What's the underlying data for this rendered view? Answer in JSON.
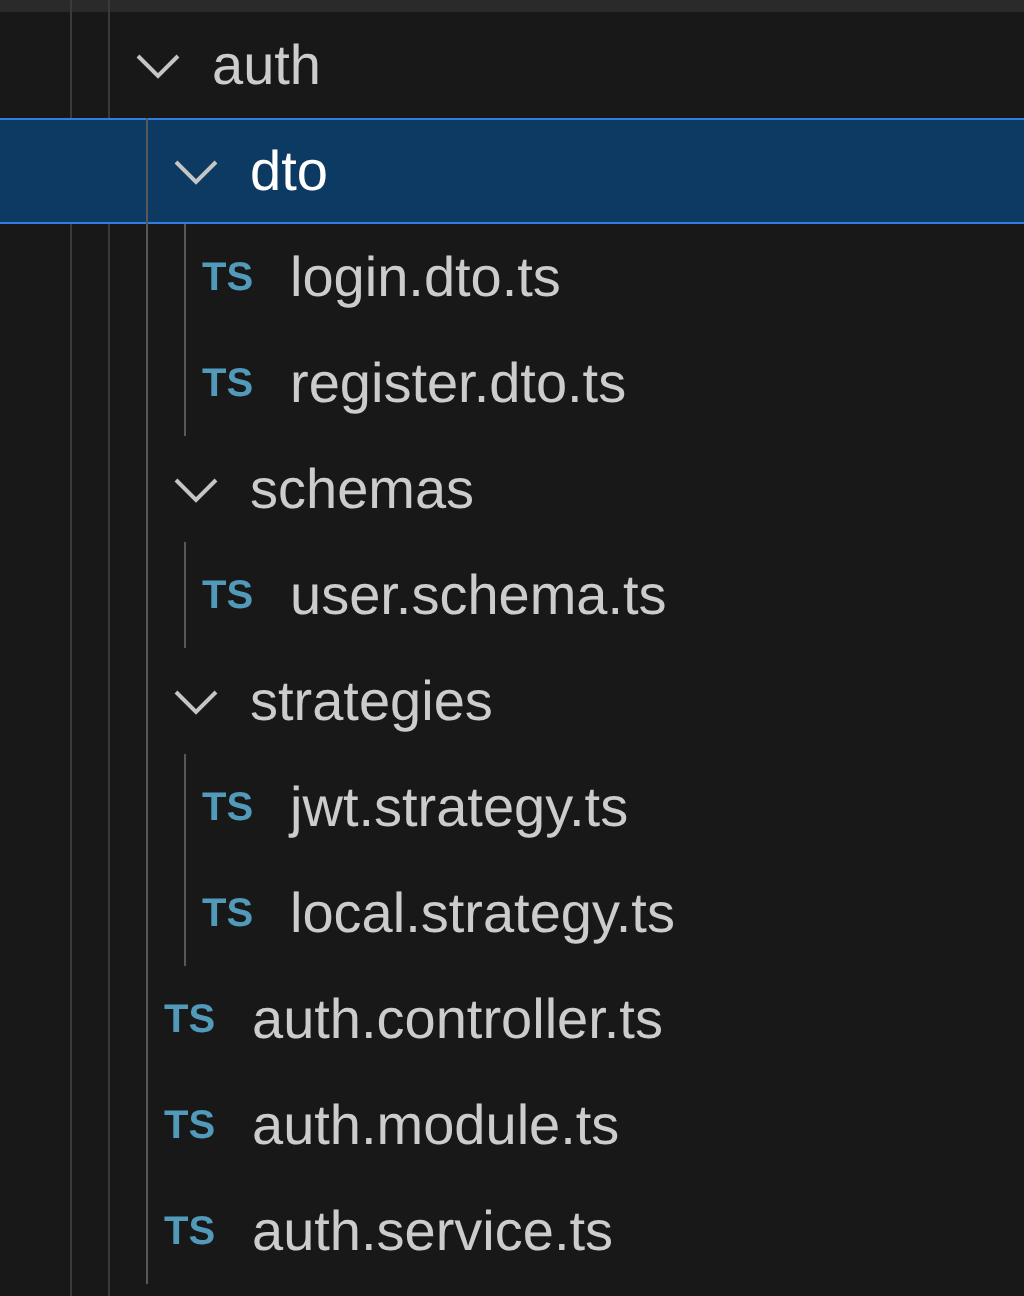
{
  "tree": [
    {
      "kind": "folder",
      "name": "auth",
      "expanded": true,
      "selected": false,
      "children": [
        {
          "kind": "folder",
          "name": "dto",
          "expanded": true,
          "selected": true,
          "children": [
            {
              "kind": "file",
              "icon": "TS",
              "name": "login.dto.ts",
              "selected": false
            },
            {
              "kind": "file",
              "icon": "TS",
              "name": "register.dto.ts",
              "selected": false
            }
          ]
        },
        {
          "kind": "folder",
          "name": "schemas",
          "expanded": true,
          "selected": false,
          "children": [
            {
              "kind": "file",
              "icon": "TS",
              "name": "user.schema.ts",
              "selected": false
            }
          ]
        },
        {
          "kind": "folder",
          "name": "strategies",
          "expanded": true,
          "selected": false,
          "children": [
            {
              "kind": "file",
              "icon": "TS",
              "name": "jwt.strategy.ts",
              "selected": false
            },
            {
              "kind": "file",
              "icon": "TS",
              "name": "local.strategy.ts",
              "selected": false
            }
          ]
        },
        {
          "kind": "file",
          "icon": "TS",
          "name": "auth.controller.ts",
          "selected": false
        },
        {
          "kind": "file",
          "icon": "TS",
          "name": "auth.module.ts",
          "selected": false
        },
        {
          "kind": "file",
          "icon": "TS",
          "name": "auth.service.ts",
          "selected": false
        }
      ]
    }
  ]
}
